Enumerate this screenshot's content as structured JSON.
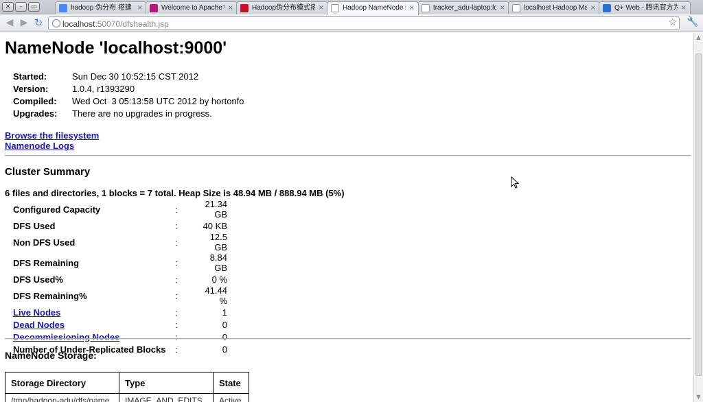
{
  "browser": {
    "tabs": [
      {
        "label": "hadoop 伪分布 搭建 -",
        "favicon_color": "#4a8af4"
      },
      {
        "label": "Welcome to Apache™",
        "favicon_color": "#b5197c"
      },
      {
        "label": "Hadoop伪分布模式搭",
        "favicon_color": "#c8102e"
      },
      {
        "label": "Hadoop NameNode l",
        "favicon_color": "#ffffff",
        "active": true
      },
      {
        "label": "tracker_adu-laptop:lo",
        "favicon_color": "#ffffff"
      },
      {
        "label": "localhost Hadoop Ma",
        "favicon_color": "#ffffff"
      },
      {
        "label": "Q+ Web - 腾讯官方为",
        "favicon_color": "#2a6fd6"
      }
    ],
    "close_glyph": "×",
    "url_host": "localhost",
    "url_rest": ":50070/dfshealth.jsp"
  },
  "page": {
    "title": "NameNode 'localhost:9000'",
    "info": [
      {
        "label": "Started:",
        "value": "Sun Dec 30 10:52:15 CST 2012"
      },
      {
        "label": "Version:",
        "value": "1.0.4, r1393290"
      },
      {
        "label": "Compiled:",
        "value": "Wed Oct  3 05:13:58 UTC 2012 by hortonfo"
      },
      {
        "label": "Upgrades:",
        "value": "There are no upgrades in progress."
      }
    ],
    "links": {
      "browse": "Browse the filesystem",
      "logs": "Namenode Logs"
    },
    "cluster_summary_heading": "Cluster Summary",
    "heap_line": "6 files and directories, 1 blocks = 7 total. Heap Size is 48.94 MB / 888.94 MB (5%)",
    "summary": [
      {
        "label": "Configured Capacity",
        "value": "21.34 GB"
      },
      {
        "label": "DFS Used",
        "value": "40 KB"
      },
      {
        "label": "Non DFS Used",
        "value": "12.5 GB"
      },
      {
        "label": "DFS Remaining",
        "value": "8.84 GB"
      },
      {
        "label": "DFS Used%",
        "value": "0 %"
      },
      {
        "label": "DFS Remaining%",
        "value": "41.44 %"
      },
      {
        "label": "Live Nodes",
        "value": "1",
        "link": true
      },
      {
        "label": "Dead Nodes",
        "value": "0",
        "link": true
      },
      {
        "label": "Decommissioning Nodes",
        "value": "0",
        "link": true
      },
      {
        "label": "Number of Under-Replicated Blocks",
        "value": "0"
      }
    ],
    "colon": ":",
    "storage_heading": "NameNode Storage:",
    "storage_columns": [
      "Storage Directory",
      "Type",
      "State"
    ],
    "storage_row_partial": [
      "/tmp/hadoop-adu/dfs/name",
      "IMAGE_AND_EDITS",
      "Active"
    ]
  }
}
